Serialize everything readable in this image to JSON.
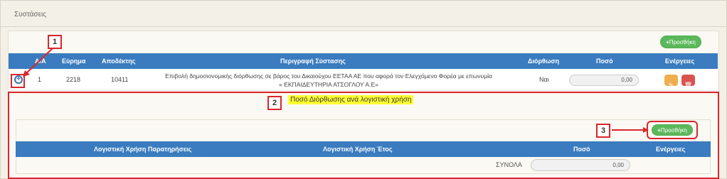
{
  "section_title": "Συστάσεις",
  "add_button": "Προσθήκη",
  "table": {
    "headers": [
      "Α/Α",
      "Εύρημα",
      "Αποδέκτης",
      "Περιγραφή Σύστασης",
      "Διόρθωση",
      "Ποσό",
      "Ενέργειες"
    ],
    "row": {
      "aa": "1",
      "finding": "2218",
      "recipient": "10411",
      "description_line1": "Επιβολή δημοσιονομικής διόρθωσης σε βάρος του Δικαιούχου ΕΕΤΑΑ ΑΕ που αφορά τον Ελεγχόμενο Φορέα με επωνυμία",
      "description_line2": "« ΕΚΠΑΙΔΕΥΤΗΡΙΑ ΑΤΣΟΓΛΟΥ Α.Ε»",
      "correction": "Ναι",
      "amount": "0,00"
    }
  },
  "sub": {
    "title": "Ποσό Διόρθωσης ανά λογιστική χρήση",
    "add_button": "Προσθήκη",
    "headers": [
      "Λογιστική Χρήση Παρατηρήσεις",
      "Λογιστική Χρήση Έτος",
      "Ποσό",
      "Ενέργειες"
    ],
    "total_label": "ΣΥΝΟΛΑ",
    "total_value": "0,00"
  },
  "annotations": [
    "1",
    "2",
    "3"
  ],
  "colors": {
    "header_blue": "#3a7cbf",
    "add_green": "#5cb85c",
    "edit_orange": "#f0ad4e",
    "delete_red": "#d9534f",
    "annotation_red": "#d9262c",
    "highlight_yellow": "#ffff33"
  }
}
